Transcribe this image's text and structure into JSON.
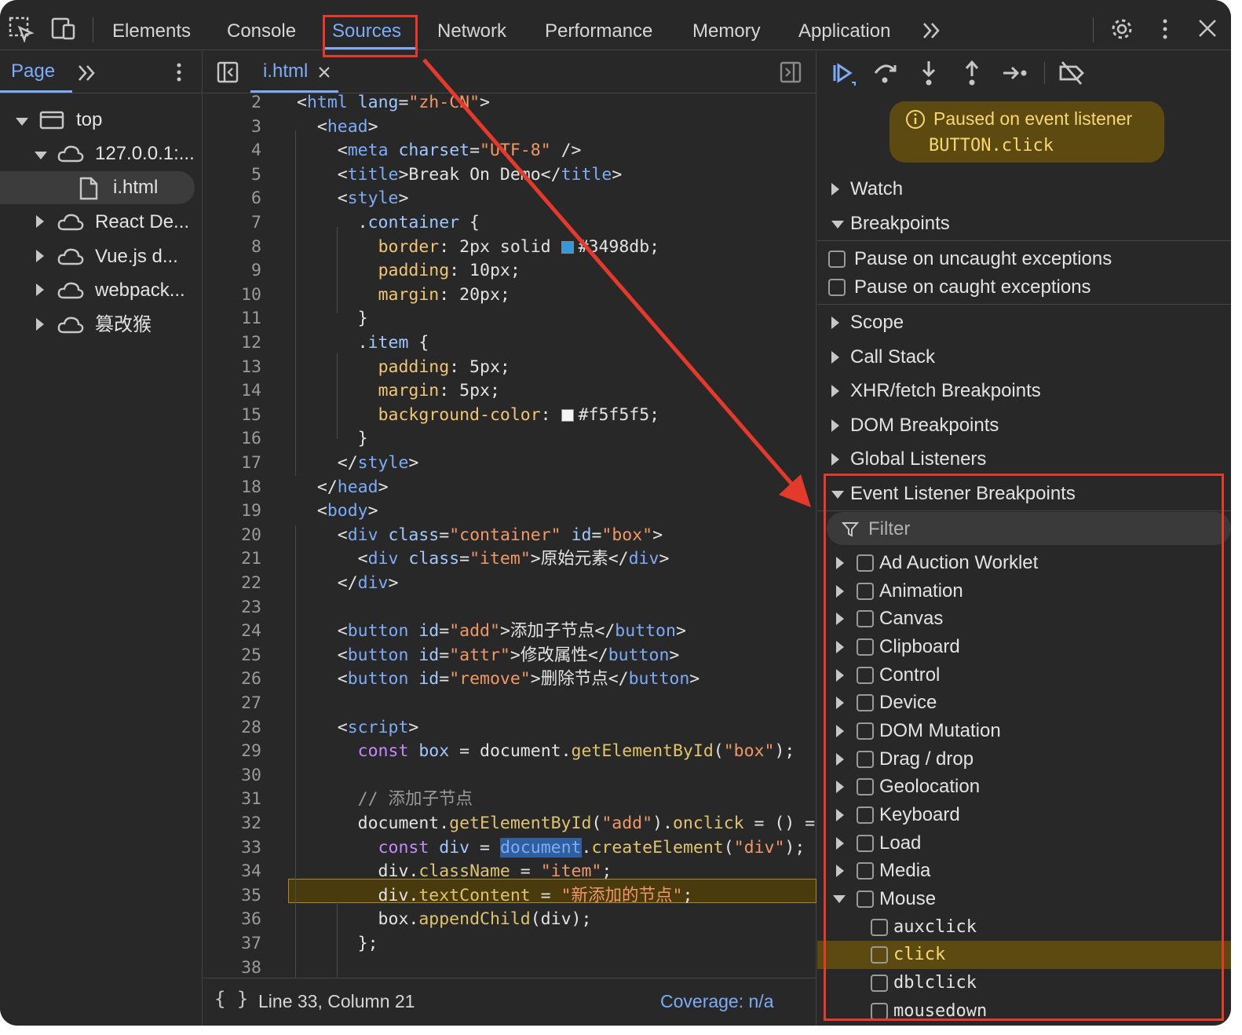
{
  "tabs": [
    "Elements",
    "Console",
    "Sources",
    "Network",
    "Performance",
    "Memory",
    "Application"
  ],
  "active_tab": "Sources",
  "left_pane": {
    "tab": "Page",
    "tree": [
      {
        "label": "top"
      },
      {
        "label": "127.0.0.1:..."
      },
      {
        "label": "i.html"
      },
      {
        "label": "React De..."
      },
      {
        "label": "Vue.js d..."
      },
      {
        "label": "webpack..."
      },
      {
        "label": "篡改猴"
      }
    ]
  },
  "editor": {
    "file_tab": "i.html",
    "line_numbers": [
      "2",
      "3",
      "4",
      "5",
      "6",
      "7",
      "8",
      "9",
      "10",
      "11",
      "12",
      "13",
      "14",
      "15",
      "16",
      "17",
      "18",
      "19",
      "20",
      "21",
      "22",
      "23",
      "24",
      "25",
      "26",
      "27",
      "28",
      "29",
      "30",
      "31",
      "32",
      "33",
      "34",
      "35",
      "36",
      "37",
      "38"
    ],
    "status_position": "Line 33, Column 21",
    "coverage": "Coverage: n/a",
    "swatch_colors": {
      "blue": "#3498db",
      "light": "#f5f5f5"
    }
  },
  "debugger": {
    "paused_title": "Paused on event listener",
    "paused_detail": "BUTTON.click",
    "sections_top": [
      "Watch",
      "Breakpoints"
    ],
    "exception_options": [
      "Pause on uncaught exceptions",
      "Pause on caught exceptions"
    ],
    "sections_mid": [
      "Scope",
      "Call Stack",
      "XHR/fetch Breakpoints",
      "DOM Breakpoints",
      "Global Listeners"
    ],
    "event_section": "Event Listener Breakpoints",
    "filter_placeholder": "Filter",
    "categories": [
      "Ad Auction Worklet",
      "Animation",
      "Canvas",
      "Clipboard",
      "Control",
      "Device",
      "DOM Mutation",
      "Drag / drop",
      "Geolocation",
      "Keyboard",
      "Load",
      "Media",
      "Mouse"
    ],
    "mouse_events": [
      "auxclick",
      "click",
      "dblclick",
      "mousedown"
    ],
    "highlighted_event": "click"
  },
  "colors": {
    "accent": "#7cacf8",
    "annotation": "#e33a2c",
    "paused_bg": "#5c4a10"
  }
}
